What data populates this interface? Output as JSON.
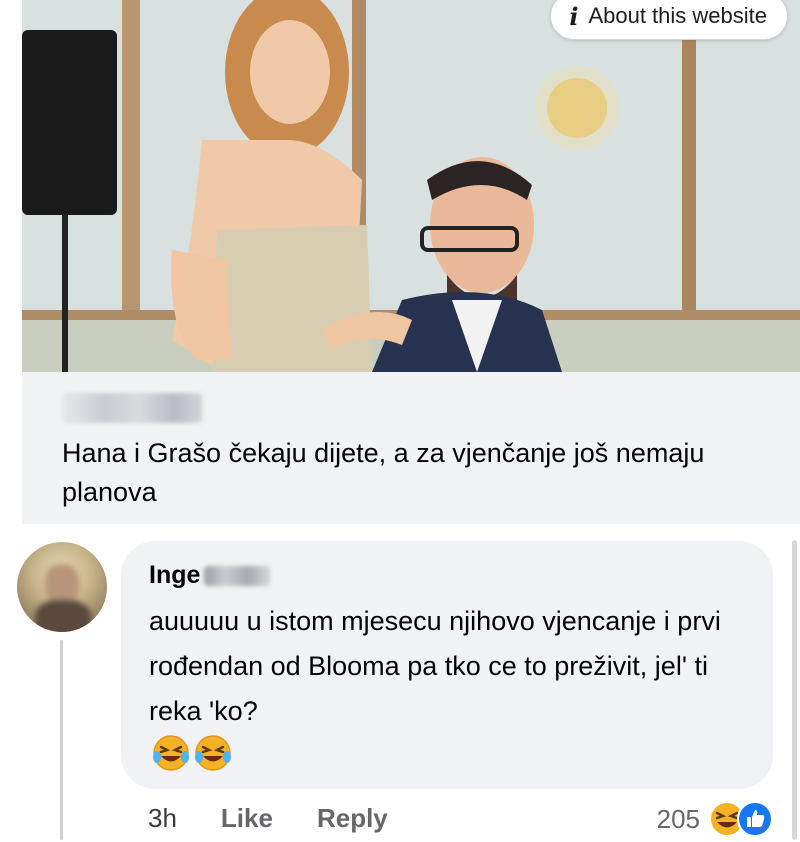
{
  "link_card": {
    "about_label": "About this website",
    "headline": "Hana i Grašo čekaju dijete, a za vjenčanje još nemaju planova"
  },
  "comment": {
    "author": "Inge",
    "text": "auuuuu u istom mjesecu njihovo vjencanje i prvi rođendan od Blooma pa tko ce to preživit, jel' ti reka 'ko?",
    "emojis": [
      "laughing-tears-emoji",
      "laughing-tears-emoji"
    ],
    "time": "3h",
    "like_label": "Like",
    "reply_label": "Reply",
    "reaction_count": "205",
    "reaction_icons": [
      "haha-reaction-icon",
      "like-reaction-icon"
    ]
  },
  "colors": {
    "background": "#ffffff",
    "card_background": "#f0f2f5",
    "bubble_background": "#f0f2f5",
    "secondary_text": "#65676b",
    "like_blue": "#1877f2",
    "haha_yellow": "#f7b125"
  }
}
